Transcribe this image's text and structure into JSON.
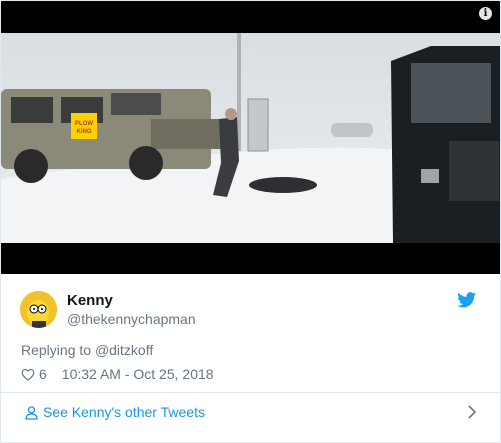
{
  "media": {
    "info_icon": "info-icon",
    "sticker_text": "PLOW KING"
  },
  "tweet": {
    "display_name": "Kenny",
    "handle": "@thekennychapman",
    "reply_prefix": "Replying to ",
    "reply_target": "@ditzkoff",
    "like_count": "6",
    "timestamp": "10:32 AM - Oct 25, 2018"
  },
  "footer": {
    "see_more": "See Kenny's other Tweets"
  },
  "colors": {
    "accent": "#1b95e0",
    "muted": "#657786",
    "text": "#14171a",
    "twitter_blue": "#1da1f2"
  }
}
